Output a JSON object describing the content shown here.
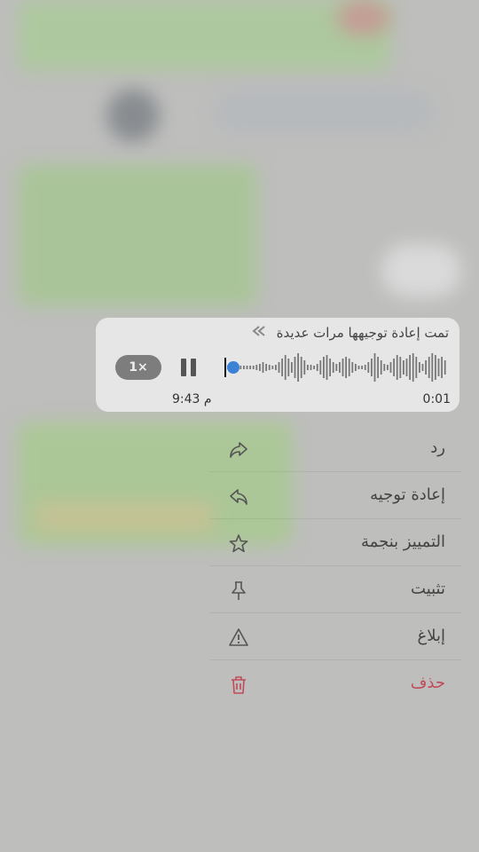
{
  "message": {
    "forwarded_label": "تمت إعادة توجيهها مرات عديدة",
    "speed": "1×",
    "time_sent": "9:43 م",
    "duration": "0:01"
  },
  "menu": {
    "items": [
      {
        "label": "رد",
        "icon": "reply-icon"
      },
      {
        "label": "إعادة توجيه",
        "icon": "forward-icon"
      },
      {
        "label": "التمييز بنجمة",
        "icon": "star-icon"
      },
      {
        "label": "تثبيت",
        "icon": "pin-icon"
      },
      {
        "label": "إبلاغ",
        "icon": "warning-icon"
      },
      {
        "label": "حذف",
        "icon": "trash-icon"
      }
    ]
  },
  "colors": {
    "delete": "#c04a5a",
    "playhead": "#3b82d6"
  }
}
